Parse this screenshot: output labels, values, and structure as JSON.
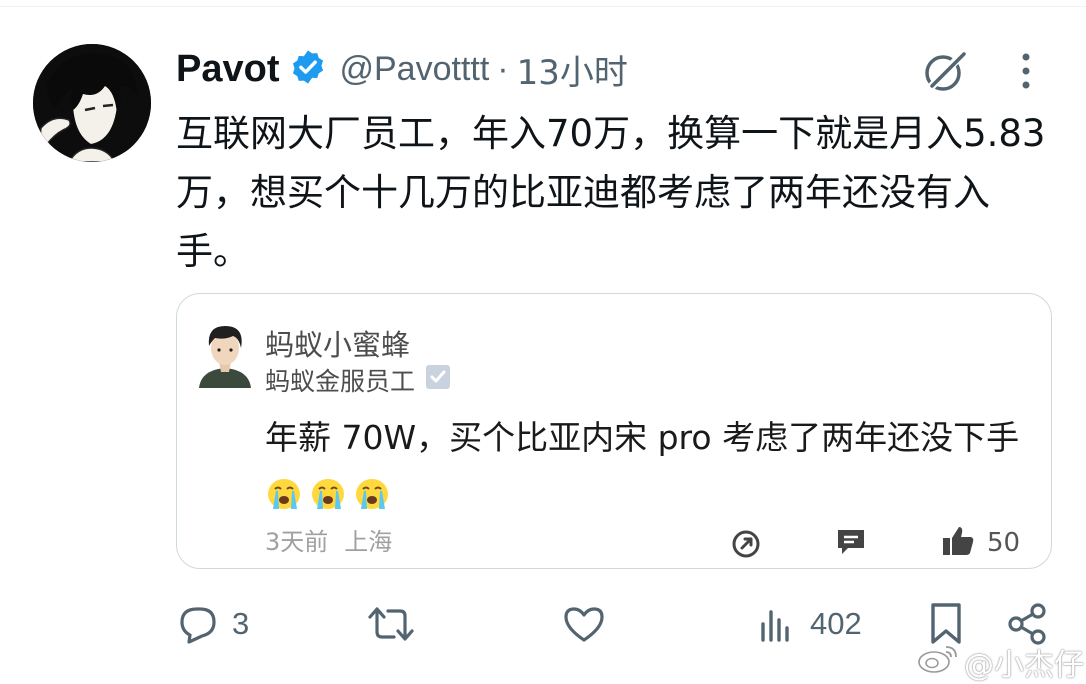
{
  "tweet": {
    "author_name": "Pavot",
    "handle": "@Pavotttt",
    "separator": "·",
    "time": "13小时",
    "text": "互联网大厂员工，年入70万，换算一下就是月入5.83万，想买个十几万的比亚迪都考虑了两年还没有入手。"
  },
  "quote": {
    "name": "蚂蚁小蜜蜂",
    "meta": "蚂蚁金服员工",
    "text": "年薪 70W，买个比亚内宋 pro 考虑了两年还没下手",
    "emojis": [
      "crying-face",
      "crying-face",
      "crying-face"
    ],
    "time_ago": "3天前",
    "location": "上海",
    "like_count": "50"
  },
  "actions": {
    "reply_count": "3",
    "retweet_count": "",
    "like_count": "",
    "views_count": "402"
  },
  "watermark": {
    "text": "@小杰仔"
  },
  "icons": {
    "verified": "verified-badge-icon",
    "grok": "grok-icon",
    "more": "more-vertical-icon",
    "reply": "reply-icon",
    "retweet": "retweet-icon",
    "like": "heart-icon",
    "views": "views-icon",
    "bookmark": "bookmark-icon",
    "share": "share-icon"
  },
  "colors": {
    "brand_blue": "#1d9bf0",
    "muted": "#536471",
    "text": "#0f1419",
    "border": "#cfd9de"
  }
}
